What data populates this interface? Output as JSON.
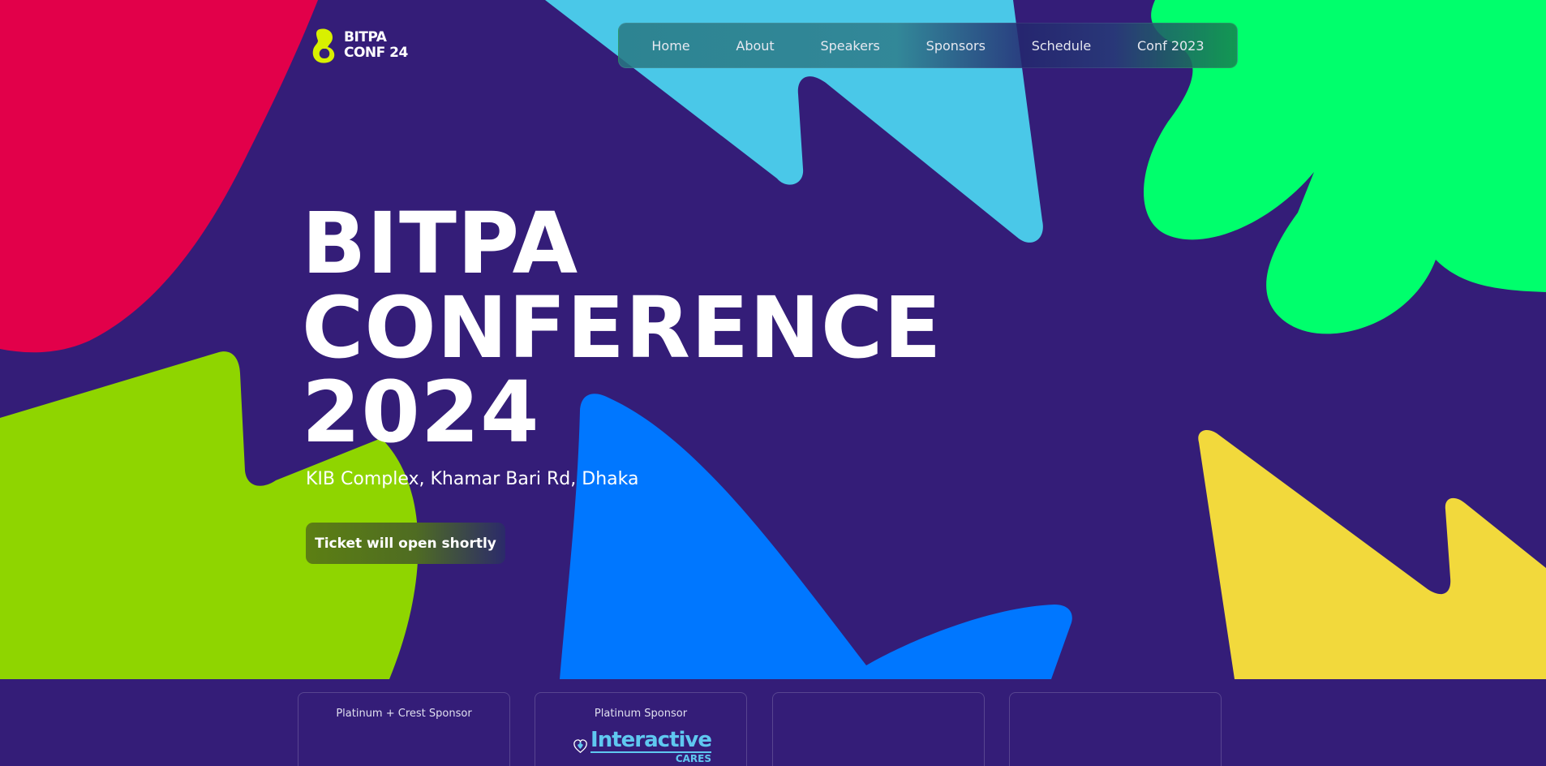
{
  "logo": {
    "line1": "BITPA",
    "line2": "CONF 24",
    "icon": "bitpa-logo-mark",
    "accent_color": "#d8f000"
  },
  "nav": {
    "items": [
      {
        "label": "Home"
      },
      {
        "label": "About"
      },
      {
        "label": "Speakers"
      },
      {
        "label": "Sponsors"
      },
      {
        "label": "Schedule"
      },
      {
        "label": "Conf 2023"
      }
    ]
  },
  "hero": {
    "title_lines": [
      "BITPA",
      "CONFERENCE",
      "2024"
    ],
    "location": "KIB Complex, Khamar Bari Rd, Dhaka",
    "cta_label": "Ticket will open shortly"
  },
  "sponsors": {
    "cards": [
      {
        "tier": "Platinum + Crest Sponsor",
        "logo": ""
      },
      {
        "tier": "Platinum Sponsor",
        "logo": "interactive-cares-logo",
        "logo_word": "Interactive",
        "logo_sub": "CARES"
      },
      {
        "tier": "",
        "logo": ""
      },
      {
        "tier": "",
        "logo": ""
      }
    ]
  },
  "colors": {
    "background": "#341d78",
    "blob_red": "#e2004a",
    "blob_cyan": "#4ac8e8",
    "blob_green": "#00ff6c",
    "blob_lime": "#8fd500",
    "blob_blue": "#0077ff",
    "blob_yellow": "#f2d93c"
  }
}
